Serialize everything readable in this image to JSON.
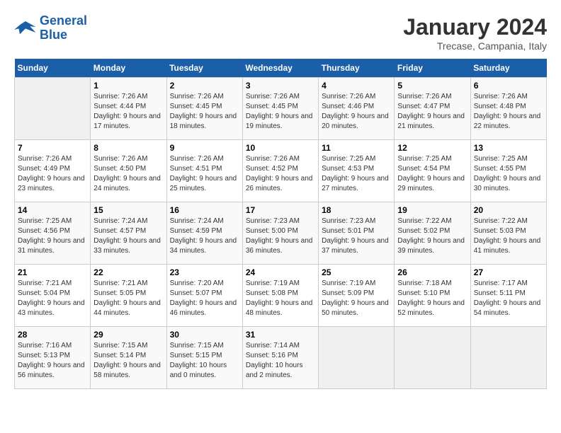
{
  "header": {
    "logo_line1": "General",
    "logo_line2": "Blue",
    "month_title": "January 2024",
    "location": "Trecase, Campania, Italy"
  },
  "days_of_week": [
    "Sunday",
    "Monday",
    "Tuesday",
    "Wednesday",
    "Thursday",
    "Friday",
    "Saturday"
  ],
  "weeks": [
    [
      {
        "day": "",
        "sunrise": "",
        "sunset": "",
        "daylight": ""
      },
      {
        "day": "1",
        "sunrise": "Sunrise: 7:26 AM",
        "sunset": "Sunset: 4:44 PM",
        "daylight": "Daylight: 9 hours and 17 minutes."
      },
      {
        "day": "2",
        "sunrise": "Sunrise: 7:26 AM",
        "sunset": "Sunset: 4:45 PM",
        "daylight": "Daylight: 9 hours and 18 minutes."
      },
      {
        "day": "3",
        "sunrise": "Sunrise: 7:26 AM",
        "sunset": "Sunset: 4:45 PM",
        "daylight": "Daylight: 9 hours and 19 minutes."
      },
      {
        "day": "4",
        "sunrise": "Sunrise: 7:26 AM",
        "sunset": "Sunset: 4:46 PM",
        "daylight": "Daylight: 9 hours and 20 minutes."
      },
      {
        "day": "5",
        "sunrise": "Sunrise: 7:26 AM",
        "sunset": "Sunset: 4:47 PM",
        "daylight": "Daylight: 9 hours and 21 minutes."
      },
      {
        "day": "6",
        "sunrise": "Sunrise: 7:26 AM",
        "sunset": "Sunset: 4:48 PM",
        "daylight": "Daylight: 9 hours and 22 minutes."
      }
    ],
    [
      {
        "day": "7",
        "sunrise": "Sunrise: 7:26 AM",
        "sunset": "Sunset: 4:49 PM",
        "daylight": "Daylight: 9 hours and 23 minutes."
      },
      {
        "day": "8",
        "sunrise": "Sunrise: 7:26 AM",
        "sunset": "Sunset: 4:50 PM",
        "daylight": "Daylight: 9 hours and 24 minutes."
      },
      {
        "day": "9",
        "sunrise": "Sunrise: 7:26 AM",
        "sunset": "Sunset: 4:51 PM",
        "daylight": "Daylight: 9 hours and 25 minutes."
      },
      {
        "day": "10",
        "sunrise": "Sunrise: 7:26 AM",
        "sunset": "Sunset: 4:52 PM",
        "daylight": "Daylight: 9 hours and 26 minutes."
      },
      {
        "day": "11",
        "sunrise": "Sunrise: 7:25 AM",
        "sunset": "Sunset: 4:53 PM",
        "daylight": "Daylight: 9 hours and 27 minutes."
      },
      {
        "day": "12",
        "sunrise": "Sunrise: 7:25 AM",
        "sunset": "Sunset: 4:54 PM",
        "daylight": "Daylight: 9 hours and 29 minutes."
      },
      {
        "day": "13",
        "sunrise": "Sunrise: 7:25 AM",
        "sunset": "Sunset: 4:55 PM",
        "daylight": "Daylight: 9 hours and 30 minutes."
      }
    ],
    [
      {
        "day": "14",
        "sunrise": "Sunrise: 7:25 AM",
        "sunset": "Sunset: 4:56 PM",
        "daylight": "Daylight: 9 hours and 31 minutes."
      },
      {
        "day": "15",
        "sunrise": "Sunrise: 7:24 AM",
        "sunset": "Sunset: 4:57 PM",
        "daylight": "Daylight: 9 hours and 33 minutes."
      },
      {
        "day": "16",
        "sunrise": "Sunrise: 7:24 AM",
        "sunset": "Sunset: 4:59 PM",
        "daylight": "Daylight: 9 hours and 34 minutes."
      },
      {
        "day": "17",
        "sunrise": "Sunrise: 7:23 AM",
        "sunset": "Sunset: 5:00 PM",
        "daylight": "Daylight: 9 hours and 36 minutes."
      },
      {
        "day": "18",
        "sunrise": "Sunrise: 7:23 AM",
        "sunset": "Sunset: 5:01 PM",
        "daylight": "Daylight: 9 hours and 37 minutes."
      },
      {
        "day": "19",
        "sunrise": "Sunrise: 7:22 AM",
        "sunset": "Sunset: 5:02 PM",
        "daylight": "Daylight: 9 hours and 39 minutes."
      },
      {
        "day": "20",
        "sunrise": "Sunrise: 7:22 AM",
        "sunset": "Sunset: 5:03 PM",
        "daylight": "Daylight: 9 hours and 41 minutes."
      }
    ],
    [
      {
        "day": "21",
        "sunrise": "Sunrise: 7:21 AM",
        "sunset": "Sunset: 5:04 PM",
        "daylight": "Daylight: 9 hours and 43 minutes."
      },
      {
        "day": "22",
        "sunrise": "Sunrise: 7:21 AM",
        "sunset": "Sunset: 5:05 PM",
        "daylight": "Daylight: 9 hours and 44 minutes."
      },
      {
        "day": "23",
        "sunrise": "Sunrise: 7:20 AM",
        "sunset": "Sunset: 5:07 PM",
        "daylight": "Daylight: 9 hours and 46 minutes."
      },
      {
        "day": "24",
        "sunrise": "Sunrise: 7:19 AM",
        "sunset": "Sunset: 5:08 PM",
        "daylight": "Daylight: 9 hours and 48 minutes."
      },
      {
        "day": "25",
        "sunrise": "Sunrise: 7:19 AM",
        "sunset": "Sunset: 5:09 PM",
        "daylight": "Daylight: 9 hours and 50 minutes."
      },
      {
        "day": "26",
        "sunrise": "Sunrise: 7:18 AM",
        "sunset": "Sunset: 5:10 PM",
        "daylight": "Daylight: 9 hours and 52 minutes."
      },
      {
        "day": "27",
        "sunrise": "Sunrise: 7:17 AM",
        "sunset": "Sunset: 5:11 PM",
        "daylight": "Daylight: 9 hours and 54 minutes."
      }
    ],
    [
      {
        "day": "28",
        "sunrise": "Sunrise: 7:16 AM",
        "sunset": "Sunset: 5:13 PM",
        "daylight": "Daylight: 9 hours and 56 minutes."
      },
      {
        "day": "29",
        "sunrise": "Sunrise: 7:15 AM",
        "sunset": "Sunset: 5:14 PM",
        "daylight": "Daylight: 9 hours and 58 minutes."
      },
      {
        "day": "30",
        "sunrise": "Sunrise: 7:15 AM",
        "sunset": "Sunset: 5:15 PM",
        "daylight": "Daylight: 10 hours and 0 minutes."
      },
      {
        "day": "31",
        "sunrise": "Sunrise: 7:14 AM",
        "sunset": "Sunset: 5:16 PM",
        "daylight": "Daylight: 10 hours and 2 minutes."
      },
      {
        "day": "",
        "sunrise": "",
        "sunset": "",
        "daylight": ""
      },
      {
        "day": "",
        "sunrise": "",
        "sunset": "",
        "daylight": ""
      },
      {
        "day": "",
        "sunrise": "",
        "sunset": "",
        "daylight": ""
      }
    ]
  ]
}
